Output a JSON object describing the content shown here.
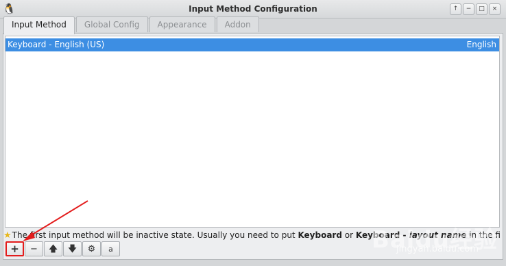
{
  "window": {
    "title": "Input Method Configuration",
    "buttons": [
      "↑",
      "−",
      "□",
      "×"
    ]
  },
  "tabs": [
    "Input Method",
    "Global Config",
    "Appearance",
    "Addon"
  ],
  "list": {
    "rows": [
      {
        "name": "Keyboard - English (US)",
        "language": "English"
      }
    ]
  },
  "hint": {
    "prefix": "The first input method will be inactive state. Usually you need to put ",
    "bold1": "Keyboard",
    "mid": " or ",
    "bold2": "Keyboard - ",
    "italic": "layout name",
    "suffix": " in the first place."
  },
  "toolbar": {
    "add": "+",
    "remove": "−",
    "up": "🡅",
    "down": "🡇",
    "configure": "⚙",
    "layout": "a"
  },
  "watermark": {
    "logo": "Baidu经验",
    "url": "jingyan.baidu.com"
  },
  "colors": {
    "selection": "#3d8ee3",
    "highlight_border": "#e31c1c"
  }
}
